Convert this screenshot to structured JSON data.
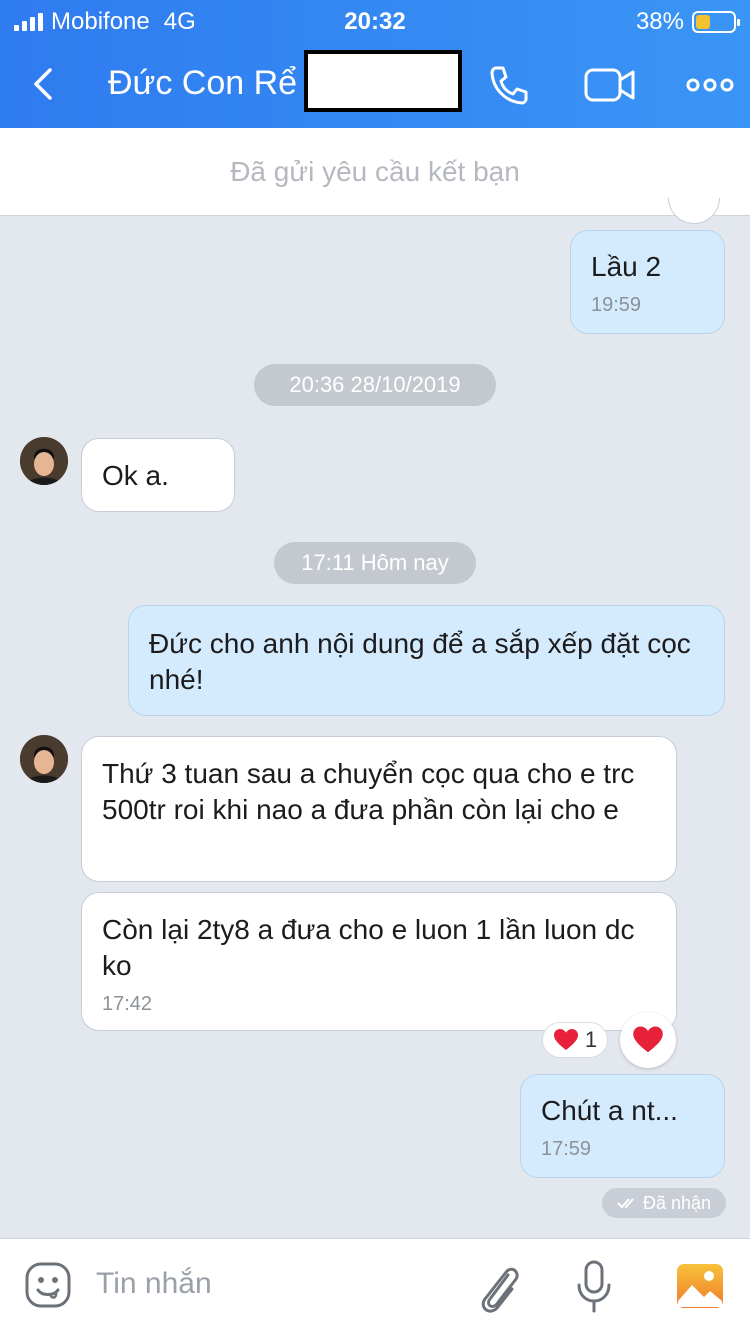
{
  "status_bar": {
    "carrier": "Mobifone",
    "network": "4G",
    "time": "20:32",
    "battery": "38%",
    "battery_level": 0.38
  },
  "header": {
    "title": "Đức Con Rể"
  },
  "friend_request": "Đã gửi yêu cầu kết bạn",
  "messages": {
    "m1": {
      "text": "Lầu 2",
      "time": "19:59"
    },
    "sep1": "20:36 28/10/2019",
    "m2": {
      "text": "Ok a."
    },
    "sep2": "17:11 Hôm nay",
    "m3": {
      "text": "Đức cho anh nội dung để a sắp xếp đặt cọc nhé!"
    },
    "m4": {
      "text": "Thứ 3 tuan sau a chuyển cọc qua cho e trc 500tr roi khi nao a đưa phần còn lại cho e"
    },
    "m5": {
      "text": "Còn lại 2ty8 a đưa cho e luon 1 lần luon dc ko",
      "time": "17:42",
      "reaction_count": "1"
    },
    "m6": {
      "text": "Chút a nt...",
      "time": "17:59"
    },
    "delivery_status": "Đã nhận"
  },
  "composer": {
    "placeholder": "Tin nhắn"
  },
  "colors": {
    "header_start": "#2f7bf0",
    "header_end": "#3a95f5",
    "outgoing": "#d4ebfd",
    "incoming": "#ffffff",
    "background": "#e3e7ee",
    "heart": "#e8213b"
  }
}
